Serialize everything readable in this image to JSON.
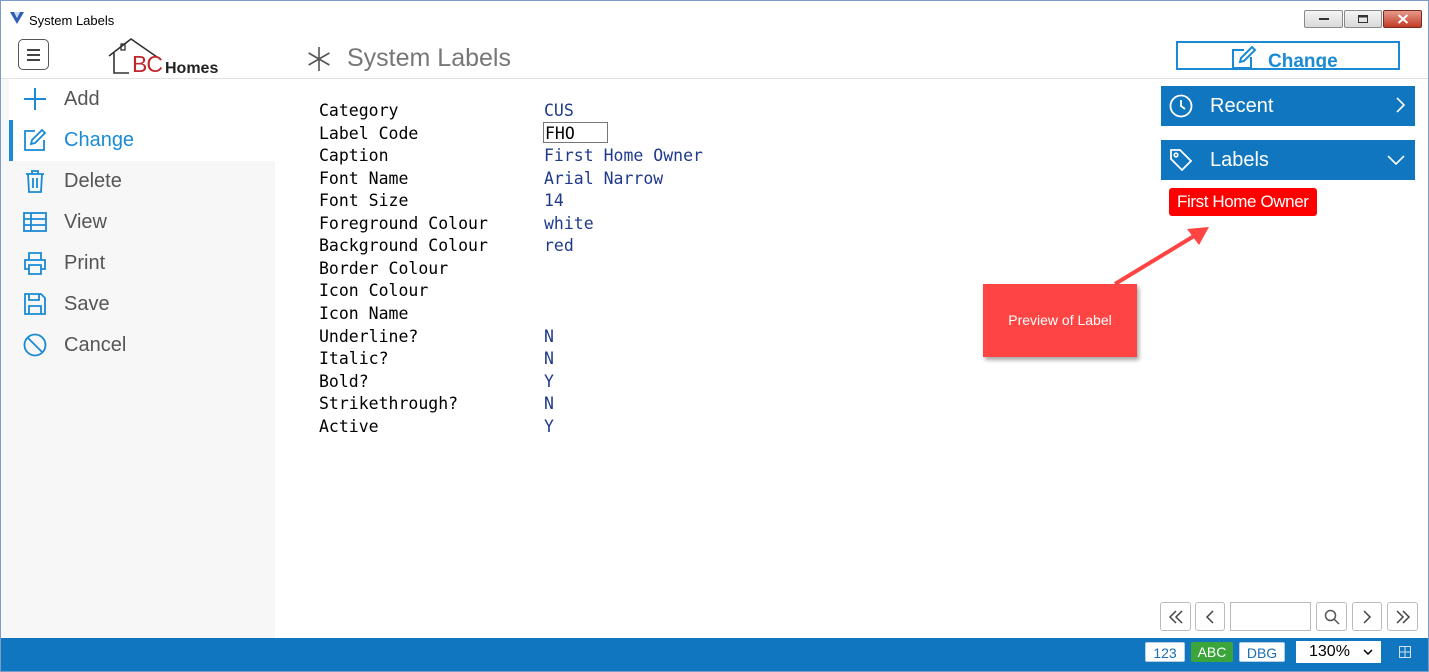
{
  "window": {
    "title": "System Labels"
  },
  "header": {
    "logo_bc": "BC",
    "logo_homes": "Homes",
    "page_title": "System Labels",
    "change_label": "Change"
  },
  "sidebar": {
    "items": [
      {
        "label": "Add",
        "icon": "plus-icon"
      },
      {
        "label": "Change",
        "icon": "edit-icon",
        "active": true
      },
      {
        "label": "Delete",
        "icon": "trash-icon"
      },
      {
        "label": "View",
        "icon": "table-icon"
      },
      {
        "label": "Print",
        "icon": "printer-icon"
      },
      {
        "label": "Save",
        "icon": "save-icon"
      },
      {
        "label": "Cancel",
        "icon": "cancel-icon"
      }
    ]
  },
  "form": {
    "fields": [
      {
        "label": "Category",
        "value": "CUS"
      },
      {
        "label": "Label Code",
        "value": "FHO"
      },
      {
        "label": "Caption",
        "value": "First Home Owner"
      },
      {
        "label": "Font Name",
        "value": "Arial Narrow"
      },
      {
        "label": "Font Size",
        "value": "14"
      },
      {
        "label": "Foreground Colour",
        "value": "white"
      },
      {
        "label": "Background Colour",
        "value": "red"
      },
      {
        "label": "Border Colour",
        "value": ""
      },
      {
        "label": "Icon Colour",
        "value": ""
      },
      {
        "label": "Icon Name",
        "value": ""
      },
      {
        "label": "Underline?",
        "value": "N"
      },
      {
        "label": "Italic?",
        "value": "N"
      },
      {
        "label": "Bold?",
        "value": "Y"
      },
      {
        "label": "Strikethrough?",
        "value": "N"
      },
      {
        "label": "Active",
        "value": "Y"
      }
    ]
  },
  "right_panel": {
    "recent_label": "Recent",
    "labels_label": "Labels",
    "preview_label_text": "First Home Owner",
    "callout_text": "Preview of Label"
  },
  "pager": {
    "page_value": ""
  },
  "statusbar": {
    "btn_123": "123",
    "btn_abc": "ABC",
    "btn_dbg": "DBG",
    "zoom": "130%"
  },
  "colors": {
    "accent": "#1a8ad4",
    "panel_blue": "#0f76bf",
    "label_red": "#ff0000",
    "callout_red": "#ff4444",
    "abc_green": "#3ba53b"
  }
}
